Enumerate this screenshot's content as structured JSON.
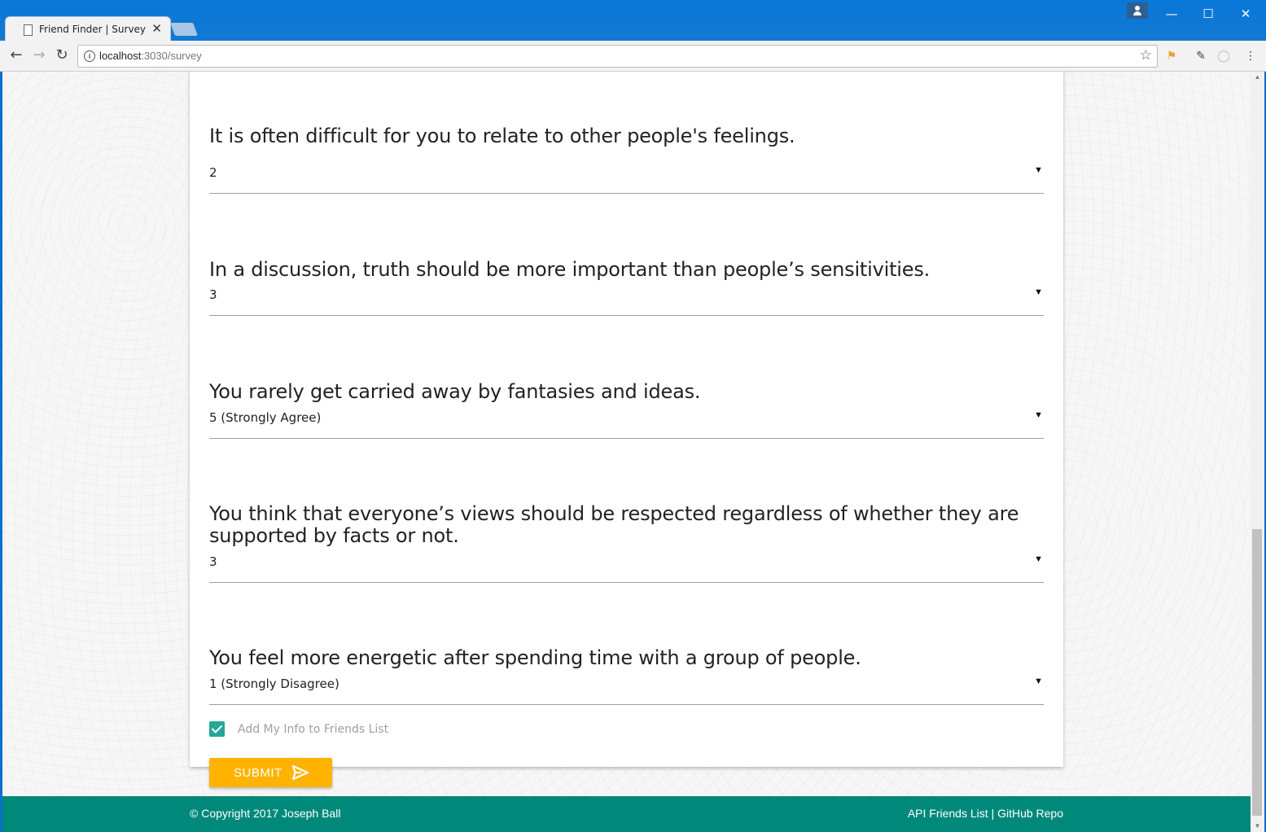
{
  "browser": {
    "tab_title": "Friend Finder | Survey",
    "tab_close": "✕",
    "url_host": "localhost",
    "url_path": ":3030/survey",
    "nav": {
      "back": "←",
      "forward": "→",
      "reload": "↻"
    },
    "window_controls": {
      "minimize": "—",
      "maximize": "☐",
      "close": "✕"
    },
    "icons": [
      "document-icon",
      "user-icon",
      "info-icon",
      "star-icon",
      "extension-icons",
      "menu-icon"
    ]
  },
  "survey": {
    "partial_question": "It is often difficult for you to relate to other people's feelings.",
    "partial_answer": "2",
    "questions": [
      {
        "text": "In a discussion, truth should be more important than people’s sensitivities.",
        "answer": "3"
      },
      {
        "text": "You rarely get carried away by fantasies and ideas.",
        "answer": "5 (Strongly Agree)"
      },
      {
        "text": "You think that everyone’s views should be respected regardless of whether they are supported by facts or not.",
        "answer": "3"
      },
      {
        "text": "You feel more energetic after spending time with a group of people.",
        "answer": "1 (Strongly Disagree)"
      }
    ],
    "checkbox_label": "Add My Info to Friends List",
    "checkbox_checked": true,
    "submit_label": "SUBMIT",
    "caret": "▼"
  },
  "footer": {
    "copyright": "© Copyright 2017 Joseph Ball",
    "link_api": "API Friends List",
    "separator": " | ",
    "link_github": "GitHub Repo"
  },
  "colors": {
    "accent": "#26a69a",
    "submit": "#ffb300",
    "footer": "#00897b",
    "titlebar": "#0a78d6"
  }
}
